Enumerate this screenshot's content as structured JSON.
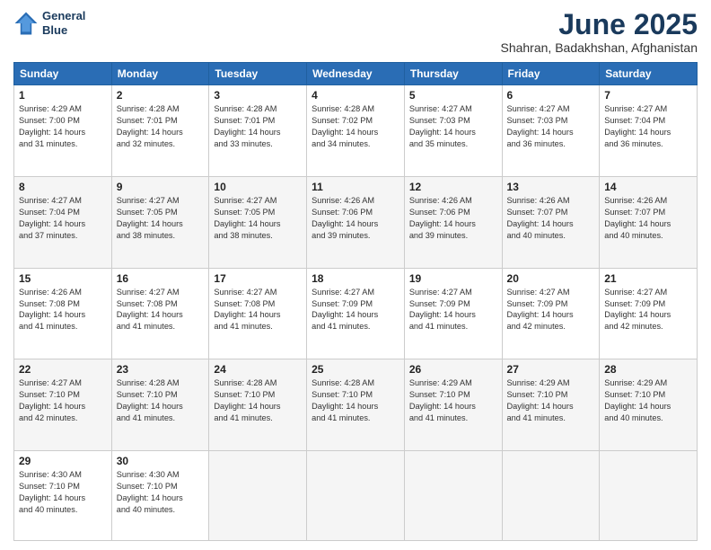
{
  "header": {
    "logo_line1": "General",
    "logo_line2": "Blue",
    "month": "June 2025",
    "location": "Shahran, Badakhshan, Afghanistan"
  },
  "weekdays": [
    "Sunday",
    "Monday",
    "Tuesday",
    "Wednesday",
    "Thursday",
    "Friday",
    "Saturday"
  ],
  "weeks": [
    [
      {
        "day": "1",
        "text": "Sunrise: 4:29 AM\nSunset: 7:00 PM\nDaylight: 14 hours\nand 31 minutes."
      },
      {
        "day": "2",
        "text": "Sunrise: 4:28 AM\nSunset: 7:01 PM\nDaylight: 14 hours\nand 32 minutes."
      },
      {
        "day": "3",
        "text": "Sunrise: 4:28 AM\nSunset: 7:01 PM\nDaylight: 14 hours\nand 33 minutes."
      },
      {
        "day": "4",
        "text": "Sunrise: 4:28 AM\nSunset: 7:02 PM\nDaylight: 14 hours\nand 34 minutes."
      },
      {
        "day": "5",
        "text": "Sunrise: 4:27 AM\nSunset: 7:03 PM\nDaylight: 14 hours\nand 35 minutes."
      },
      {
        "day": "6",
        "text": "Sunrise: 4:27 AM\nSunset: 7:03 PM\nDaylight: 14 hours\nand 36 minutes."
      },
      {
        "day": "7",
        "text": "Sunrise: 4:27 AM\nSunset: 7:04 PM\nDaylight: 14 hours\nand 36 minutes."
      }
    ],
    [
      {
        "day": "8",
        "text": "Sunrise: 4:27 AM\nSunset: 7:04 PM\nDaylight: 14 hours\nand 37 minutes."
      },
      {
        "day": "9",
        "text": "Sunrise: 4:27 AM\nSunset: 7:05 PM\nDaylight: 14 hours\nand 38 minutes."
      },
      {
        "day": "10",
        "text": "Sunrise: 4:27 AM\nSunset: 7:05 PM\nDaylight: 14 hours\nand 38 minutes."
      },
      {
        "day": "11",
        "text": "Sunrise: 4:26 AM\nSunset: 7:06 PM\nDaylight: 14 hours\nand 39 minutes."
      },
      {
        "day": "12",
        "text": "Sunrise: 4:26 AM\nSunset: 7:06 PM\nDaylight: 14 hours\nand 39 minutes."
      },
      {
        "day": "13",
        "text": "Sunrise: 4:26 AM\nSunset: 7:07 PM\nDaylight: 14 hours\nand 40 minutes."
      },
      {
        "day": "14",
        "text": "Sunrise: 4:26 AM\nSunset: 7:07 PM\nDaylight: 14 hours\nand 40 minutes."
      }
    ],
    [
      {
        "day": "15",
        "text": "Sunrise: 4:26 AM\nSunset: 7:08 PM\nDaylight: 14 hours\nand 41 minutes."
      },
      {
        "day": "16",
        "text": "Sunrise: 4:27 AM\nSunset: 7:08 PM\nDaylight: 14 hours\nand 41 minutes."
      },
      {
        "day": "17",
        "text": "Sunrise: 4:27 AM\nSunset: 7:08 PM\nDaylight: 14 hours\nand 41 minutes."
      },
      {
        "day": "18",
        "text": "Sunrise: 4:27 AM\nSunset: 7:09 PM\nDaylight: 14 hours\nand 41 minutes."
      },
      {
        "day": "19",
        "text": "Sunrise: 4:27 AM\nSunset: 7:09 PM\nDaylight: 14 hours\nand 41 minutes."
      },
      {
        "day": "20",
        "text": "Sunrise: 4:27 AM\nSunset: 7:09 PM\nDaylight: 14 hours\nand 42 minutes."
      },
      {
        "day": "21",
        "text": "Sunrise: 4:27 AM\nSunset: 7:09 PM\nDaylight: 14 hours\nand 42 minutes."
      }
    ],
    [
      {
        "day": "22",
        "text": "Sunrise: 4:27 AM\nSunset: 7:10 PM\nDaylight: 14 hours\nand 42 minutes."
      },
      {
        "day": "23",
        "text": "Sunrise: 4:28 AM\nSunset: 7:10 PM\nDaylight: 14 hours\nand 41 minutes."
      },
      {
        "day": "24",
        "text": "Sunrise: 4:28 AM\nSunset: 7:10 PM\nDaylight: 14 hours\nand 41 minutes."
      },
      {
        "day": "25",
        "text": "Sunrise: 4:28 AM\nSunset: 7:10 PM\nDaylight: 14 hours\nand 41 minutes."
      },
      {
        "day": "26",
        "text": "Sunrise: 4:29 AM\nSunset: 7:10 PM\nDaylight: 14 hours\nand 41 minutes."
      },
      {
        "day": "27",
        "text": "Sunrise: 4:29 AM\nSunset: 7:10 PM\nDaylight: 14 hours\nand 41 minutes."
      },
      {
        "day": "28",
        "text": "Sunrise: 4:29 AM\nSunset: 7:10 PM\nDaylight: 14 hours\nand 40 minutes."
      }
    ],
    [
      {
        "day": "29",
        "text": "Sunrise: 4:30 AM\nSunset: 7:10 PM\nDaylight: 14 hours\nand 40 minutes."
      },
      {
        "day": "30",
        "text": "Sunrise: 4:30 AM\nSunset: 7:10 PM\nDaylight: 14 hours\nand 40 minutes."
      },
      {
        "day": "",
        "text": ""
      },
      {
        "day": "",
        "text": ""
      },
      {
        "day": "",
        "text": ""
      },
      {
        "day": "",
        "text": ""
      },
      {
        "day": "",
        "text": ""
      }
    ]
  ]
}
